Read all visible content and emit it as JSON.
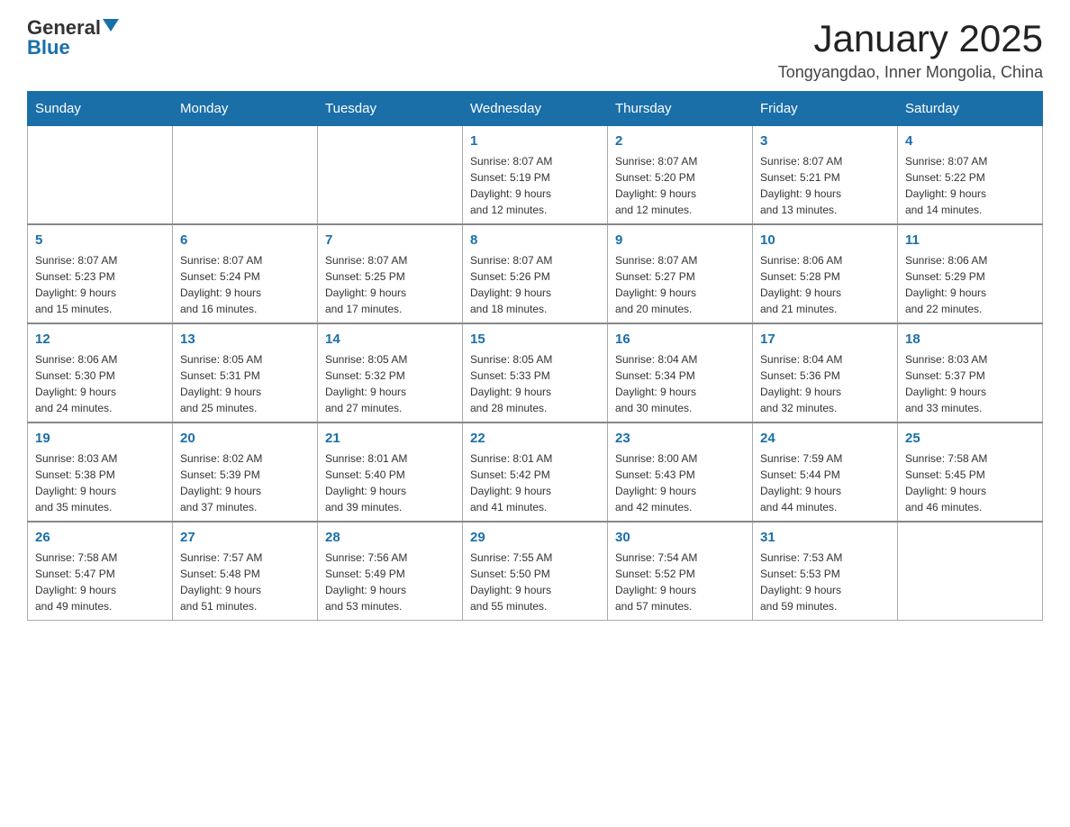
{
  "header": {
    "logo_general": "General",
    "logo_blue": "Blue",
    "title": "January 2025",
    "subtitle": "Tongyangdao, Inner Mongolia, China"
  },
  "days_of_week": [
    "Sunday",
    "Monday",
    "Tuesday",
    "Wednesday",
    "Thursday",
    "Friday",
    "Saturday"
  ],
  "weeks": [
    [
      {
        "day": "",
        "info": ""
      },
      {
        "day": "",
        "info": ""
      },
      {
        "day": "",
        "info": ""
      },
      {
        "day": "1",
        "info": "Sunrise: 8:07 AM\nSunset: 5:19 PM\nDaylight: 9 hours\nand 12 minutes."
      },
      {
        "day": "2",
        "info": "Sunrise: 8:07 AM\nSunset: 5:20 PM\nDaylight: 9 hours\nand 12 minutes."
      },
      {
        "day": "3",
        "info": "Sunrise: 8:07 AM\nSunset: 5:21 PM\nDaylight: 9 hours\nand 13 minutes."
      },
      {
        "day": "4",
        "info": "Sunrise: 8:07 AM\nSunset: 5:22 PM\nDaylight: 9 hours\nand 14 minutes."
      }
    ],
    [
      {
        "day": "5",
        "info": "Sunrise: 8:07 AM\nSunset: 5:23 PM\nDaylight: 9 hours\nand 15 minutes."
      },
      {
        "day": "6",
        "info": "Sunrise: 8:07 AM\nSunset: 5:24 PM\nDaylight: 9 hours\nand 16 minutes."
      },
      {
        "day": "7",
        "info": "Sunrise: 8:07 AM\nSunset: 5:25 PM\nDaylight: 9 hours\nand 17 minutes."
      },
      {
        "day": "8",
        "info": "Sunrise: 8:07 AM\nSunset: 5:26 PM\nDaylight: 9 hours\nand 18 minutes."
      },
      {
        "day": "9",
        "info": "Sunrise: 8:07 AM\nSunset: 5:27 PM\nDaylight: 9 hours\nand 20 minutes."
      },
      {
        "day": "10",
        "info": "Sunrise: 8:06 AM\nSunset: 5:28 PM\nDaylight: 9 hours\nand 21 minutes."
      },
      {
        "day": "11",
        "info": "Sunrise: 8:06 AM\nSunset: 5:29 PM\nDaylight: 9 hours\nand 22 minutes."
      }
    ],
    [
      {
        "day": "12",
        "info": "Sunrise: 8:06 AM\nSunset: 5:30 PM\nDaylight: 9 hours\nand 24 minutes."
      },
      {
        "day": "13",
        "info": "Sunrise: 8:05 AM\nSunset: 5:31 PM\nDaylight: 9 hours\nand 25 minutes."
      },
      {
        "day": "14",
        "info": "Sunrise: 8:05 AM\nSunset: 5:32 PM\nDaylight: 9 hours\nand 27 minutes."
      },
      {
        "day": "15",
        "info": "Sunrise: 8:05 AM\nSunset: 5:33 PM\nDaylight: 9 hours\nand 28 minutes."
      },
      {
        "day": "16",
        "info": "Sunrise: 8:04 AM\nSunset: 5:34 PM\nDaylight: 9 hours\nand 30 minutes."
      },
      {
        "day": "17",
        "info": "Sunrise: 8:04 AM\nSunset: 5:36 PM\nDaylight: 9 hours\nand 32 minutes."
      },
      {
        "day": "18",
        "info": "Sunrise: 8:03 AM\nSunset: 5:37 PM\nDaylight: 9 hours\nand 33 minutes."
      }
    ],
    [
      {
        "day": "19",
        "info": "Sunrise: 8:03 AM\nSunset: 5:38 PM\nDaylight: 9 hours\nand 35 minutes."
      },
      {
        "day": "20",
        "info": "Sunrise: 8:02 AM\nSunset: 5:39 PM\nDaylight: 9 hours\nand 37 minutes."
      },
      {
        "day": "21",
        "info": "Sunrise: 8:01 AM\nSunset: 5:40 PM\nDaylight: 9 hours\nand 39 minutes."
      },
      {
        "day": "22",
        "info": "Sunrise: 8:01 AM\nSunset: 5:42 PM\nDaylight: 9 hours\nand 41 minutes."
      },
      {
        "day": "23",
        "info": "Sunrise: 8:00 AM\nSunset: 5:43 PM\nDaylight: 9 hours\nand 42 minutes."
      },
      {
        "day": "24",
        "info": "Sunrise: 7:59 AM\nSunset: 5:44 PM\nDaylight: 9 hours\nand 44 minutes."
      },
      {
        "day": "25",
        "info": "Sunrise: 7:58 AM\nSunset: 5:45 PM\nDaylight: 9 hours\nand 46 minutes."
      }
    ],
    [
      {
        "day": "26",
        "info": "Sunrise: 7:58 AM\nSunset: 5:47 PM\nDaylight: 9 hours\nand 49 minutes."
      },
      {
        "day": "27",
        "info": "Sunrise: 7:57 AM\nSunset: 5:48 PM\nDaylight: 9 hours\nand 51 minutes."
      },
      {
        "day": "28",
        "info": "Sunrise: 7:56 AM\nSunset: 5:49 PM\nDaylight: 9 hours\nand 53 minutes."
      },
      {
        "day": "29",
        "info": "Sunrise: 7:55 AM\nSunset: 5:50 PM\nDaylight: 9 hours\nand 55 minutes."
      },
      {
        "day": "30",
        "info": "Sunrise: 7:54 AM\nSunset: 5:52 PM\nDaylight: 9 hours\nand 57 minutes."
      },
      {
        "day": "31",
        "info": "Sunrise: 7:53 AM\nSunset: 5:53 PM\nDaylight: 9 hours\nand 59 minutes."
      },
      {
        "day": "",
        "info": ""
      }
    ]
  ]
}
